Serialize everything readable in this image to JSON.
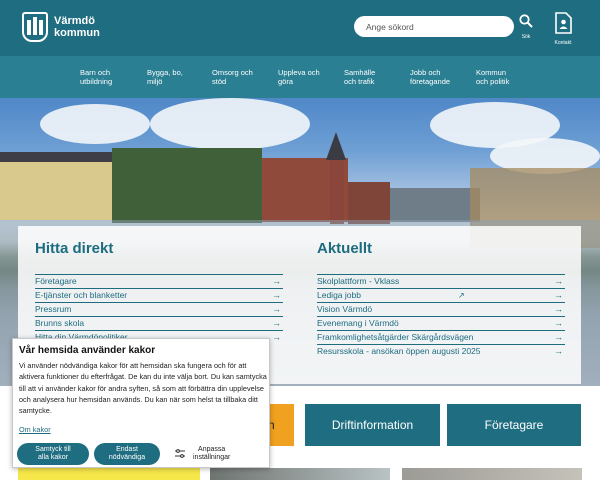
{
  "header": {
    "logo_line1": "Värmdö",
    "logo_line2": "kommun",
    "search_placeholder": "Ange sökord",
    "search_label": "Sök",
    "contact_label": "Kontakt"
  },
  "nav": [
    {
      "line1": "Barn och",
      "line2": "utbildning"
    },
    {
      "line1": "Bygga, bo,",
      "line2": "miljö"
    },
    {
      "line1": "Omsorg och",
      "line2": "stöd"
    },
    {
      "line1": "Uppleva och",
      "line2": "göra"
    },
    {
      "line1": "Samhälle",
      "line2": "och trafik"
    },
    {
      "line1": "Jobb och",
      "line2": "företagande"
    },
    {
      "line1": "Kommun",
      "line2": "och politik"
    }
  ],
  "hitta_direkt": {
    "title": "Hitta direkt",
    "links": [
      "Företagare",
      "E-tjänster och blanketter",
      "Pressrum",
      "Brunns skola",
      "Hitta din Värmdöpolitiker"
    ]
  },
  "aktuellt": {
    "title": "Aktuellt",
    "links": [
      "Skolplattform - Vklass",
      "Lediga jobb",
      "Vision Värmdö",
      "Evenemang i Värmdö",
      "Framkomlighetsåtgärder Skärgårdsvägen",
      "Resursskola - ansökan öppen augusti 2025"
    ]
  },
  "cards": {
    "orange_partial": "n",
    "driftinformation": "Driftinformation",
    "foretagare": "Företagare"
  },
  "cookie": {
    "title": "Vår hemsida använder kakor",
    "text": "Vi använder nödvändiga kakor för att hemsidan ska fungera och för att aktivera funktioner du efterfrågat. De kan du inte välja bort. Du kan samtycka till att vi använder kakor för andra syften, så som att förbättra din upplevelse och analysera hur hemsidan används. Du kan när som helst ta tillbaka ditt samtycke.",
    "more_link": "Om kakor",
    "accept_line1": "Samtyck till",
    "accept_line2": "alla kakor",
    "necessary_line1": "Endast",
    "necessary_line2": "nödvändiga",
    "customize_line1": "Anpassa",
    "customize_line2": "inställningar"
  },
  "colors": {
    "brand": "#1f6d80",
    "nav": "#2a7f93",
    "link": "#1e6c7f",
    "accent_orange": "#f0a11f",
    "accent_yellow": "#f6e74b"
  },
  "icons": {
    "logo": "castle-logo-icon",
    "search": "search-icon",
    "contact": "contact-card-icon",
    "link": "arrow-right-icon",
    "external": "external-link-icon",
    "settings": "sliders-icon"
  }
}
